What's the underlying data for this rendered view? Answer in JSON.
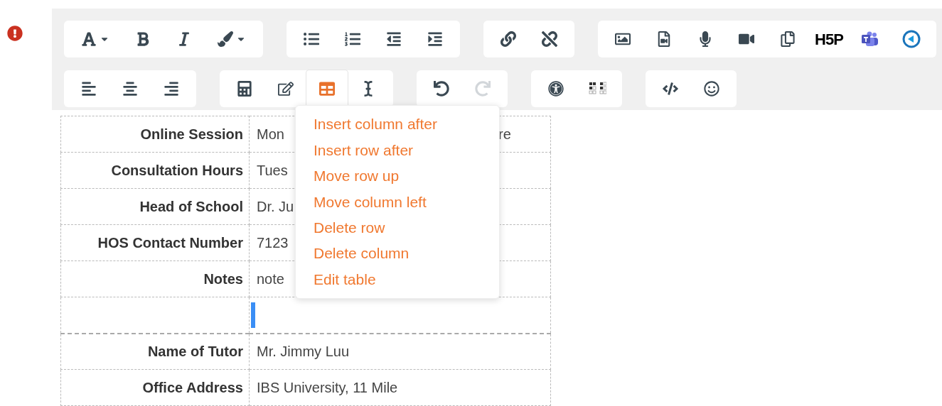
{
  "toolbar": {
    "rows": [
      {
        "groups": [
          {
            "buttons": [
              {
                "active": false,
                "disabled": false
              },
              {
                "active": false,
                "disabled": false
              },
              {
                "active": false,
                "disabled": false
              },
              {
                "active": false,
                "disabled": false
              }
            ]
          },
          {
            "buttons": [
              {
                "active": false,
                "disabled": false
              },
              {
                "active": false,
                "disabled": false
              },
              {
                "active": false,
                "disabled": false
              },
              {
                "active": false,
                "disabled": false
              }
            ]
          },
          {
            "buttons": [
              {
                "active": false,
                "disabled": false
              },
              {
                "active": false,
                "disabled": false
              }
            ]
          },
          {
            "buttons": [
              {
                "active": false,
                "disabled": false
              },
              {
                "active": false,
                "disabled": false
              },
              {
                "active": false,
                "disabled": false
              },
              {
                "active": false,
                "disabled": false
              },
              {
                "active": false,
                "disabled": false
              },
              {
                "active": false,
                "disabled": false,
                "text": "H5P"
              },
              {
                "active": false,
                "disabled": false
              },
              {
                "active": false,
                "disabled": false
              }
            ]
          }
        ]
      },
      {
        "groups": [
          {
            "buttons": [
              {
                "active": false,
                "disabled": false
              },
              {
                "active": false,
                "disabled": false
              },
              {
                "active": false,
                "disabled": false
              }
            ]
          },
          {
            "buttons": [
              {
                "active": false,
                "disabled": false
              },
              {
                "active": false,
                "disabled": false
              },
              {
                "active": true,
                "disabled": false
              },
              {
                "active": false,
                "disabled": false
              }
            ]
          },
          {
            "buttons": [
              {
                "active": false,
                "disabled": false
              },
              {
                "active": false,
                "disabled": true
              }
            ]
          },
          {
            "buttons": [
              {
                "active": false,
                "disabled": false
              },
              {
                "active": false,
                "disabled": false
              }
            ]
          },
          {
            "buttons": [
              {
                "active": false,
                "disabled": false
              },
              {
                "active": false,
                "disabled": false
              }
            ]
          }
        ]
      }
    ]
  },
  "table": {
    "rows": [
      {
        "label": "Online Session",
        "value": [
          "Mon",
          "re"
        ],
        "emphasized_border": false
      },
      {
        "label": "Consultation Hours",
        "value": [
          "Tues"
        ],
        "emphasized_border": false
      },
      {
        "label": "Head of School",
        "value": [
          "Dr. Ju"
        ],
        "emphasized_border": false
      },
      {
        "label": "HOS Contact Number",
        "value": [
          "7123"
        ],
        "emphasized_border": false
      },
      {
        "label": "Notes",
        "value": [
          "note"
        ],
        "emphasized_border": false
      },
      {
        "value": [],
        "cursor": true,
        "emphasized_border": true
      },
      {
        "label": "Name of Tutor",
        "value": [
          "Mr. Jimmy Luu"
        ],
        "emphasized_border": false
      },
      {
        "label": "Office Address",
        "value": [
          "IBS University, 11 Mile"
        ],
        "emphasized_border": false
      }
    ]
  },
  "context_menu": {
    "items": [
      "Insert column after",
      "Insert row after",
      "Move row up",
      "Move column left",
      "Delete row",
      "Delete column",
      "Edit table"
    ]
  }
}
